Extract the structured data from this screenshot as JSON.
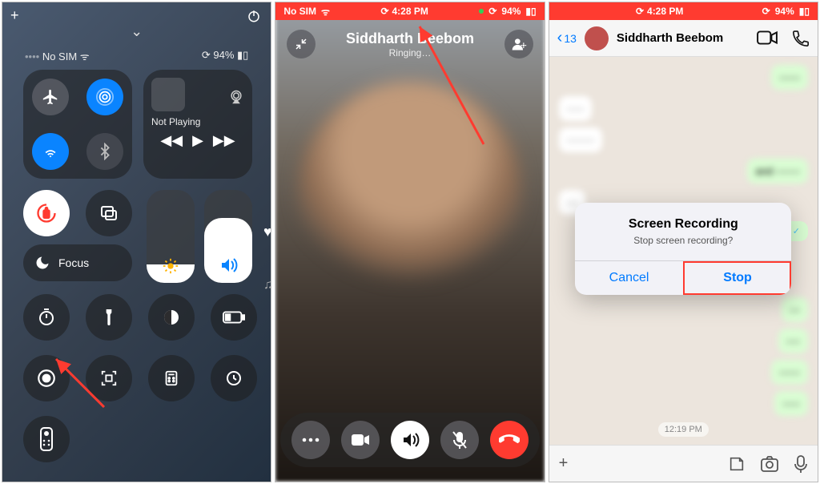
{
  "pane1": {
    "status": {
      "carrier": "No SIM",
      "battery_pct": "94%"
    },
    "media_label": "Not Playing",
    "focus_label": "Focus"
  },
  "pane2": {
    "status": {
      "carrier": "No SIM",
      "time": "4:28 PM",
      "battery_pct": "94%"
    },
    "call": {
      "name": "Siddharth Beebom",
      "status": "Ringing…"
    }
  },
  "pane3": {
    "status": {
      "time": "4:28 PM",
      "battery_pct": "94%"
    },
    "back_count": "13",
    "contact": "Siddharth Beebom",
    "alert": {
      "title": "Screen Recording",
      "message": "Stop screen recording?",
      "cancel": "Cancel",
      "stop": "Stop"
    },
    "chat": {
      "bubbles": [
        "------",
        "-----",
        "--------",
        "and -------",
        "---",
        "---",
        "----",
        "------",
        "-----"
      ],
      "timestamp": "12:19 PM"
    }
  }
}
